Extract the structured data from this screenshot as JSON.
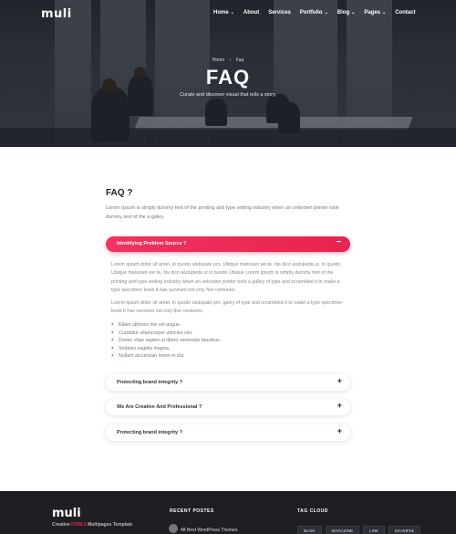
{
  "brand": {
    "logo": "muli",
    "accent": "#e8234f"
  },
  "nav": {
    "items": [
      {
        "label": "Home",
        "has_dropdown": true
      },
      {
        "label": "About",
        "has_dropdown": false
      },
      {
        "label": "Services",
        "has_dropdown": false
      },
      {
        "label": "Portfolio",
        "has_dropdown": true
      },
      {
        "label": "Blog",
        "has_dropdown": true
      },
      {
        "label": "Pages",
        "has_dropdown": true
      },
      {
        "label": "Contact",
        "has_dropdown": false
      }
    ],
    "chevron": "⌄"
  },
  "hero": {
    "breadcrumb_home": "Home",
    "breadcrumb_sep": "›",
    "breadcrumb_current": "Faq",
    "title": "FAQ",
    "subtitle": "Curate and discover visual that tells a story."
  },
  "faq": {
    "title": "FAQ ?",
    "intro": "Lorem Ipsum is simply dummy text of the printing and type setting industry when an unknown printer took dummy text of the a galey.",
    "open_item": {
      "question": "Identifying Problem Source ?",
      "toggle": "−",
      "paragraph1": "Lorem ipsum dolor sit amet, in quodo alutupate pro. Ubique malusset vel te, his dico alutupeda ut. In quodo Ubique malusset ver te, his dico alutupeda ut in quodo Ubique Lorem Ipsum is simply dummy text of the printing and type setting industry when an unknown printer took a galley of type and scrambled it to make a type specimen book It has survived not only five centuries.",
      "paragraph2": "Lorem ipsum dolor sit amet, in quodo alutupate pro. galey of type and scrambled it to make a type specimen book It has survived not only five centuries.",
      "bullets": [
        "Etiam ultricies nisi vel augue.",
        "Curabitur ullamcorper ultricies nisi.",
        "Donec vitae sapien ut libero venenatis faucibus.",
        "Sodales sagittis magna.",
        "Nullam accumsan lorem in dui."
      ]
    },
    "items": [
      {
        "question": "Protecting brand integrity ?",
        "toggle": "+"
      },
      {
        "question": "We Are Creative And Professional ?",
        "toggle": "+"
      },
      {
        "question": "Protecting brand integrity ?",
        "toggle": "+"
      }
    ]
  },
  "footer": {
    "logo": "muli",
    "tagline_pre": "Creative",
    "tagline_accent": "HTML5",
    "tagline_post": "Multipages Template",
    "recent_posts_heading": "RECENT POSTES",
    "recent_post_title": "48 Best WordPress Themes",
    "tag_cloud_heading": "TAG CLOUD",
    "tags": [
      "BLOG",
      "MAGAZINE",
      "LINK",
      "EXAMPLE"
    ]
  }
}
